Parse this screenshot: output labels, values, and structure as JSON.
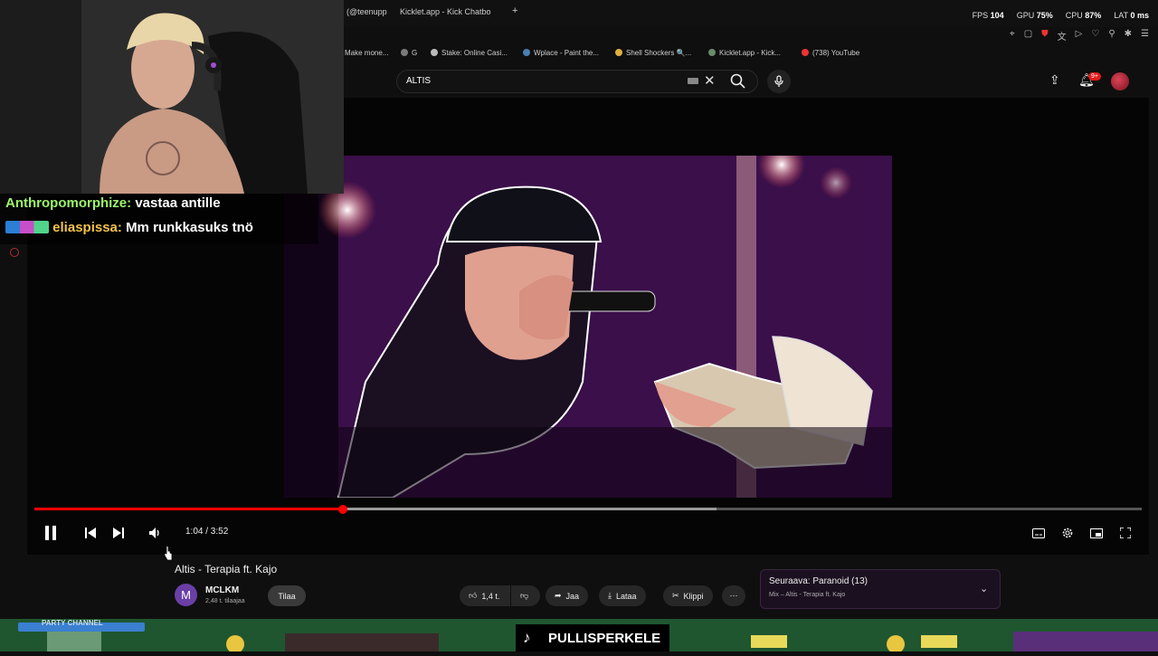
{
  "browser": {
    "tabs": [
      {
        "label": "(@teenupp"
      },
      {
        "label": "Kicklet.app - Kick Chatbo"
      },
      {
        "label": "+"
      }
    ],
    "perf": {
      "fps_label": "FPS",
      "fps_value": "104",
      "gpu_label": "GPU",
      "gpu_value": "75%",
      "cpu_label": "CPU",
      "cpu_value": "87%",
      "lat_label": "LAT",
      "lat_value": "0 ms"
    },
    "bookmarks": [
      {
        "label": "Make mone..."
      },
      {
        "label": "G"
      },
      {
        "label": "Stake: Online Casi..."
      },
      {
        "label": "Wplace - Paint the..."
      },
      {
        "label": "Shell Shockers 🔍..."
      },
      {
        "label": "Kicklet.app - Kick..."
      },
      {
        "label": "(738) YouTube"
      }
    ]
  },
  "youtube": {
    "search_query": "ALTIS",
    "notification_count": "9+",
    "player": {
      "time": "1:04 / 3:52",
      "played_fraction": 0.279,
      "buffered_fraction": 0.616
    },
    "video": {
      "title": "Altis - Terapia ft. Kajo",
      "channel_initial": "M",
      "channel": "MCLKM",
      "subscribers": "2,48 t. tilaajaa",
      "subscribe_label": "Tilaa",
      "likes": "1,4 t.",
      "share_label": "Jaa",
      "download_label": "Lataa",
      "clip_label": "Klippi"
    },
    "next": {
      "title": "Seuraava: Paranoid (13)",
      "subtitle": "Mix – Altis - Terapia ft. Kajo"
    }
  },
  "stream": {
    "chat": [
      {
        "user": "Anthropomorphize:",
        "message": "vastaa antille",
        "color": "#9cf56b"
      },
      {
        "user": "eliaspissa:",
        "message": "Mm runkkasuks tnö",
        "color": "#f3c24b"
      }
    ],
    "overlay_name": "PULLISPERKELE",
    "banner_text": "PARTY CHANNEL"
  },
  "colors": {
    "accent_red": "#ff0000",
    "banner_green": "#1d4b2a"
  }
}
